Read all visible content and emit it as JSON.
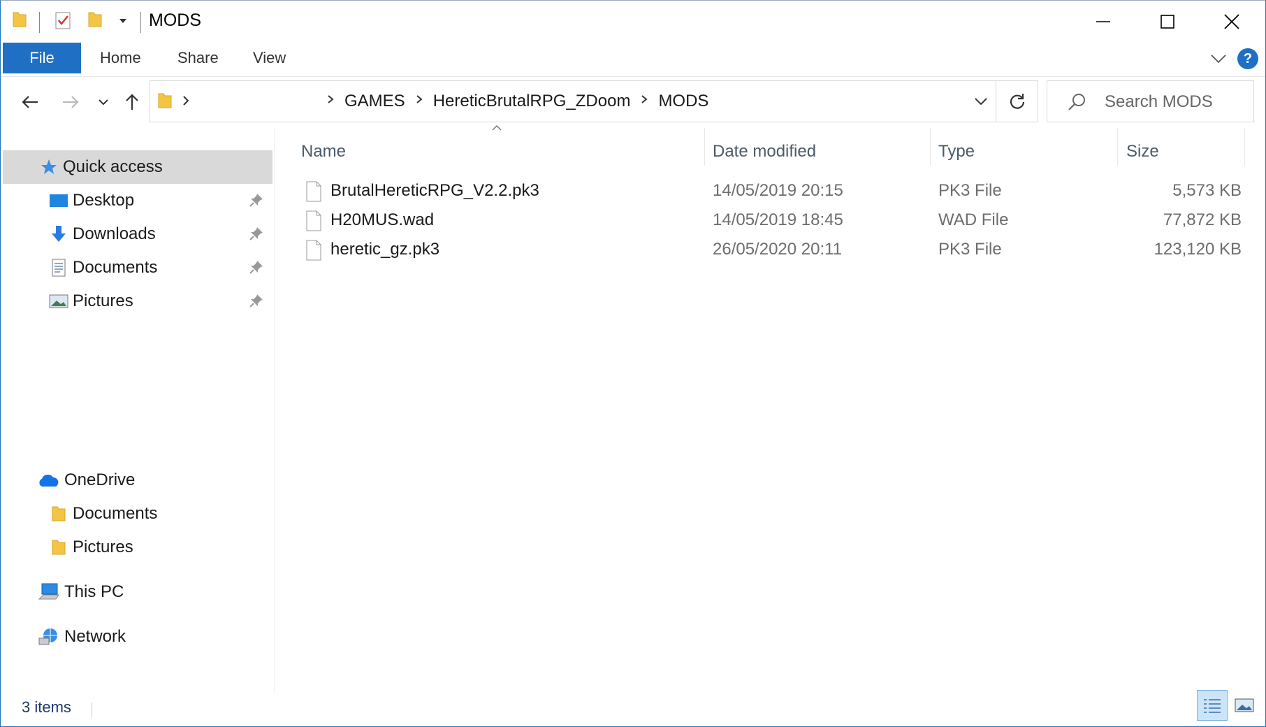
{
  "window": {
    "title": "MODS",
    "controls": {
      "minimize": "minimize",
      "maximize": "maximize",
      "close": "close"
    }
  },
  "quick_access_toolbar": [
    "folder-icon",
    "properties-icon",
    "new-folder-icon",
    "dropdown-arrow-icon"
  ],
  "ribbon": {
    "tabs": [
      "File",
      "Home",
      "Share",
      "View"
    ],
    "help_label": "?"
  },
  "address": {
    "breadcrumbs": [
      "GAMES",
      "HereticBrutalRPG_ZDoom",
      "MODS"
    ],
    "search_placeholder": "Search MODS"
  },
  "sidebar": {
    "quick_access": {
      "label": "Quick access",
      "items": [
        {
          "label": "Desktop",
          "icon": "desktop-icon",
          "pinned": true
        },
        {
          "label": "Downloads",
          "icon": "downloads-icon",
          "pinned": true
        },
        {
          "label": "Documents",
          "icon": "documents-icon",
          "pinned": true
        },
        {
          "label": "Pictures",
          "icon": "pictures-icon",
          "pinned": true
        }
      ]
    },
    "onedrive": {
      "label": "OneDrive",
      "items": [
        {
          "label": "Documents",
          "icon": "folder-icon"
        },
        {
          "label": "Pictures",
          "icon": "folder-icon"
        }
      ]
    },
    "this_pc": {
      "label": "This PC"
    },
    "network": {
      "label": "Network"
    }
  },
  "columns": [
    "Name",
    "Date modified",
    "Type",
    "Size"
  ],
  "files": [
    {
      "name": "BrutalHereticRPG_V2.2.pk3",
      "modified": "14/05/2019 20:15",
      "type": "PK3 File",
      "size": "5,573 KB"
    },
    {
      "name": "H20MUS.wad",
      "modified": "14/05/2019 18:45",
      "type": "WAD File",
      "size": "77,872 KB"
    },
    {
      "name": "heretic_gz.pk3",
      "modified": "26/05/2020 20:11",
      "type": "PK3 File",
      "size": "123,120 KB"
    }
  ],
  "status": {
    "item_count": "3 items"
  },
  "colors": {
    "accent": "#1f6fc5",
    "selected_bg": "#d9d9d9",
    "folder": "#f4c542"
  }
}
